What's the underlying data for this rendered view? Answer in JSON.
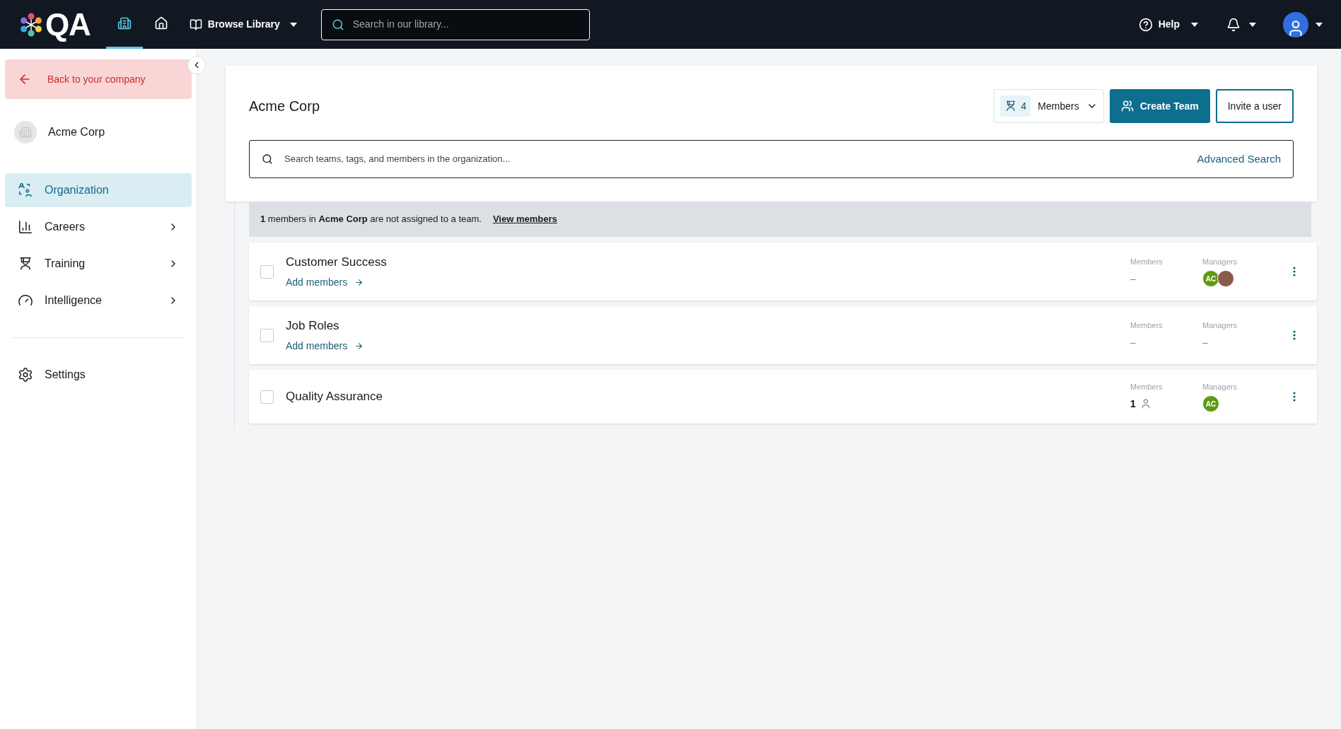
{
  "topbar": {
    "logo": "QA",
    "nav": [
      {
        "kind": "company",
        "selected": true
      },
      {
        "kind": "home",
        "selected": false
      }
    ],
    "browse": "Browse Library",
    "search_placeholder": "Search in our library...",
    "help": "Help"
  },
  "sidebar": {
    "back": "Back to your company",
    "company": "Acme Corp",
    "items": [
      {
        "label": "Organization",
        "selected": true,
        "has_children": false
      },
      {
        "label": "Careers",
        "selected": false,
        "has_children": true
      },
      {
        "label": "Training",
        "selected": false,
        "has_children": true
      },
      {
        "label": "Intelligence",
        "selected": false,
        "has_children": true
      }
    ],
    "settings": "Settings"
  },
  "header": {
    "title": "Acme Corp",
    "count": "4",
    "members_dropdown": "Members",
    "create": "Create Team",
    "invite": "Invite a user",
    "search_placeholder": "Search teams, tags, and members in the organization...",
    "advanced": "Advanced Search"
  },
  "banner": {
    "text": "**1** members in **Acme Corp** are not assigned to a team.",
    "link": "View members"
  },
  "teams": [
    {
      "name": "Customer Success",
      "checked": false,
      "add": "Add members",
      "members_label": "Members",
      "members": "–",
      "members_icon": false,
      "managers_label": "Managers",
      "managers": [
        {
          "kind": "initials",
          "text": "AC",
          "color": "#5f9a10"
        },
        {
          "kind": "photo"
        }
      ]
    },
    {
      "name": "Job Roles",
      "checked": false,
      "add": "Add members",
      "members_label": "Members",
      "members": "–",
      "members_icon": false,
      "managers_label": "Managers",
      "managers_empty": "–"
    },
    {
      "name": "Quality Assurance",
      "checked": false,
      "members_label": "Members",
      "members": "1",
      "members_icon": true,
      "managers_label": "Managers",
      "managers": [
        {
          "kind": "initials",
          "text": "AC",
          "color": "#5f9a10"
        }
      ]
    }
  ]
}
